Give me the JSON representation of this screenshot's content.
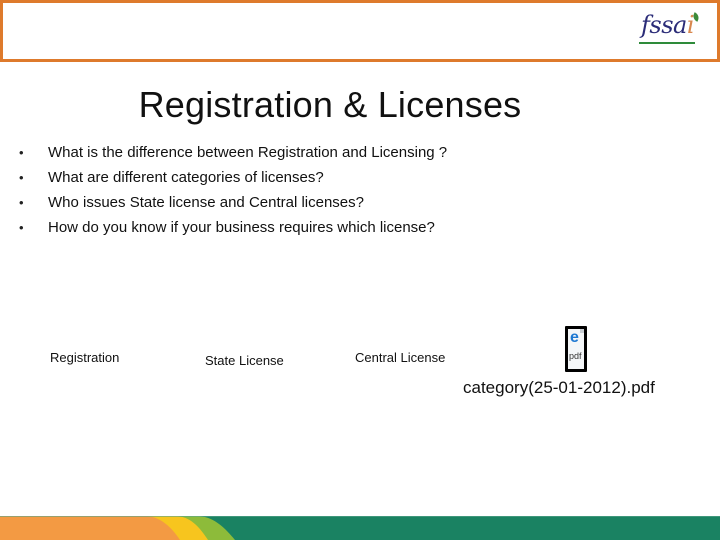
{
  "header": {
    "logo_text": "fssa",
    "logo_accent": "i",
    "frame_color": "#DE7A2C"
  },
  "title": "Registration & Licenses",
  "bullets": [
    "What is the difference between Registration and Licensing ?",
    "What are different categories of licenses?",
    "Who issues State license and Central licenses?",
    "How do you know if your business requires which license?"
  ],
  "bullet_glyph": "•",
  "links": {
    "registration": "Registration",
    "state_license": "State License",
    "central_license": "Central License"
  },
  "attachment": {
    "icon": "pdf-file-icon",
    "icon_letter": "e",
    "icon_ext": "pdf",
    "filename": "category(25-01-2012).pdf"
  },
  "footer": {
    "colors": {
      "orange": "#F39A43",
      "yellow": "#F7C51E",
      "light_green": "#8DBB3A",
      "dark_green": "#1A8262"
    }
  }
}
